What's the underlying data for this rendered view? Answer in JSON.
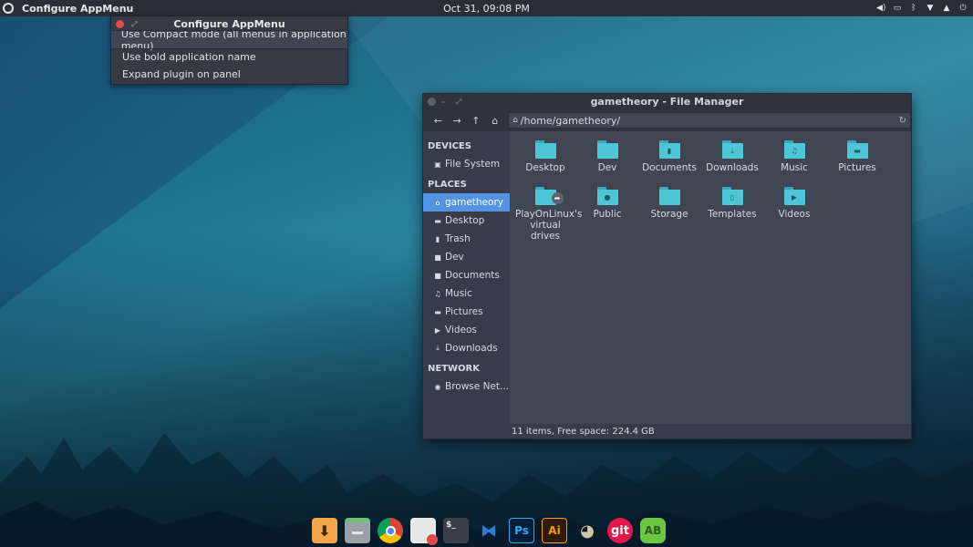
{
  "top_panel": {
    "app_name": "Configure AppMenu",
    "clock": "Oct 31, 09:08 PM",
    "tray_icons": [
      "volume-icon",
      "keyboard-icon",
      "bluetooth-icon",
      "wifi-icon",
      "notification-icon",
      "power-icon"
    ]
  },
  "appmenu_window": {
    "title": "Configure AppMenu",
    "options": [
      {
        "label": "Use Compact mode (all menus in application menu)",
        "checked": false,
        "highlighted": true
      },
      {
        "label": "Use bold application name",
        "checked": false,
        "highlighted": false
      },
      {
        "label": "Expand plugin on panel",
        "checked": false,
        "highlighted": false
      }
    ]
  },
  "file_manager": {
    "title": "gametheory - File Manager",
    "path": "/home/gametheory/",
    "sidebar": {
      "devices_header": "DEVICES",
      "devices": [
        {
          "label": "File System",
          "icon": "drive-icon"
        }
      ],
      "places_header": "PLACES",
      "places": [
        {
          "label": "gametheory",
          "icon": "home-icon",
          "active": true
        },
        {
          "label": "Desktop",
          "icon": "desktop-icon"
        },
        {
          "label": "Trash",
          "icon": "trash-icon"
        },
        {
          "label": "Dev",
          "icon": "folder-icon"
        },
        {
          "label": "Documents",
          "icon": "document-icon"
        },
        {
          "label": "Music",
          "icon": "music-icon"
        },
        {
          "label": "Pictures",
          "icon": "pictures-icon"
        },
        {
          "label": "Videos",
          "icon": "video-icon"
        },
        {
          "label": "Downloads",
          "icon": "download-icon"
        }
      ],
      "network_header": "NETWORK",
      "network": [
        {
          "label": "Browse Net...",
          "icon": "network-icon"
        }
      ]
    },
    "items": [
      {
        "label": "Desktop",
        "icon": "folder-icon"
      },
      {
        "label": "Dev",
        "icon": "folder-icon"
      },
      {
        "label": "Documents",
        "icon": "folder-documents-icon"
      },
      {
        "label": "Downloads",
        "icon": "folder-download-icon"
      },
      {
        "label": "Music",
        "icon": "folder-music-icon"
      },
      {
        "label": "Pictures",
        "icon": "folder-pictures-icon"
      },
      {
        "label": "PlayOnLinux's virtual drives",
        "icon": "folder-link-icon"
      },
      {
        "label": "Public",
        "icon": "folder-public-icon"
      },
      {
        "label": "Storage",
        "icon": "folder-icon"
      },
      {
        "label": "Templates",
        "icon": "folder-templates-icon"
      },
      {
        "label": "Videos",
        "icon": "folder-videos-icon"
      }
    ],
    "status": "11 items, Free space: 224.4 GB"
  },
  "dock": [
    {
      "name": "downloader",
      "icon": "download-arrow-icon",
      "color": "#f2a54a"
    },
    {
      "name": "file-manager",
      "icon": "file-cabinet-icon",
      "color": "#9aa0a6"
    },
    {
      "name": "chrome",
      "icon": "chrome-icon",
      "color": "#db4437"
    },
    {
      "name": "text-editor",
      "icon": "text-editor-icon",
      "color": "#e8e8e8"
    },
    {
      "name": "terminal",
      "icon": "terminal-icon",
      "color": "#3a3f4a"
    },
    {
      "name": "vscode",
      "icon": "vscode-icon",
      "color": "#2c7fd1"
    },
    {
      "name": "photoshop",
      "icon": "photoshop-icon",
      "color": "#001e36"
    },
    {
      "name": "illustrator",
      "icon": "illustrator-icon",
      "color": "#2e1d06"
    },
    {
      "name": "gimp",
      "icon": "gimp-icon",
      "color": "#6d5a43"
    },
    {
      "name": "git",
      "icon": "git-icon",
      "color": "#e2184a"
    },
    {
      "name": "appbuilder",
      "icon": "appbuilder-icon",
      "color": "#6cc644"
    }
  ],
  "dock_labels": {
    "terminal": "$_",
    "photoshop": "Ps",
    "illustrator": "Ai",
    "git": "git",
    "appbuilder": "AB"
  }
}
